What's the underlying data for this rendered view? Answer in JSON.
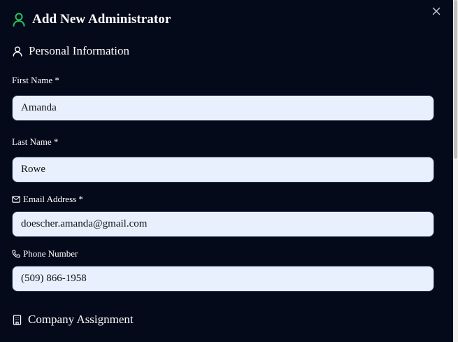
{
  "dialog": {
    "title": "Add New Administrator",
    "title_icon": "user-icon",
    "close_icon": "close-icon"
  },
  "sections": {
    "personal": {
      "title": "Personal Information",
      "icon": "user-icon"
    },
    "company": {
      "title": "Company Assignment",
      "icon": "building-icon"
    }
  },
  "fields": {
    "first_name": {
      "label": "First Name *",
      "value": "Amanda"
    },
    "last_name": {
      "label": "Last Name *",
      "value": "Rowe"
    },
    "email": {
      "label": "Email Address *",
      "value": "doescher.amanda@gmail.com",
      "icon": "mail-icon"
    },
    "phone": {
      "label": "Phone Number",
      "value": "(509) 866-1958",
      "icon": "phone-icon"
    }
  },
  "colors": {
    "background": "#050a1a",
    "accent_green": "#22c55e",
    "input_background": "#e8f0fe"
  }
}
